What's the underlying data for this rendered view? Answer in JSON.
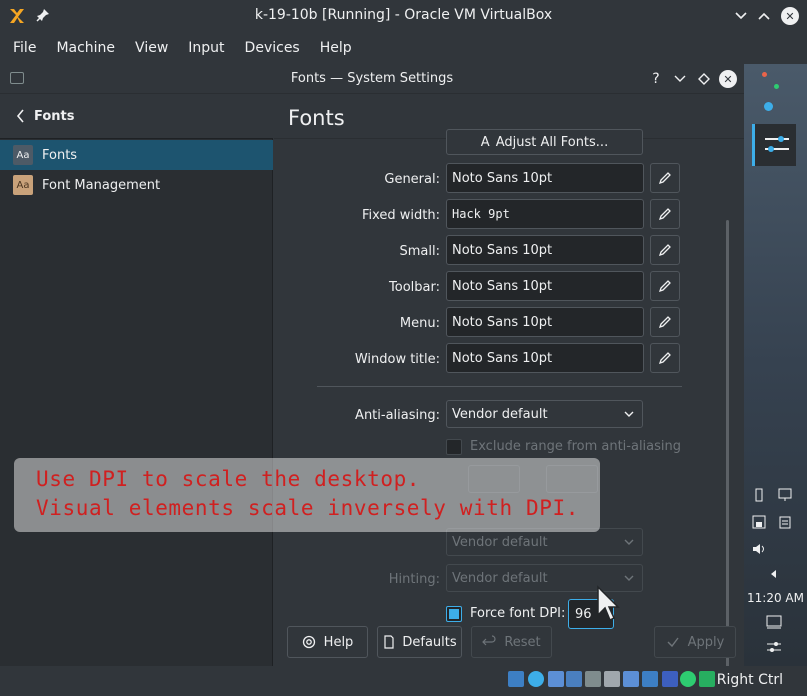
{
  "host_window": {
    "title": "k-19-10b [Running] - Oracle VM VirtualBox",
    "menu": [
      "File",
      "Machine",
      "View",
      "Input",
      "Devices",
      "Help"
    ],
    "host_key_label": "Right Ctrl"
  },
  "settings_window": {
    "title": "Fonts — System Settings",
    "help_button": "?"
  },
  "sidebar": {
    "back_title": "Fonts",
    "items": [
      {
        "label": "Fonts",
        "icon": "font-icon",
        "active": true
      },
      {
        "label": "Font Management",
        "icon": "font-management-icon",
        "active": false
      }
    ]
  },
  "main": {
    "page_title": "Fonts",
    "adjust_all_button": "Adjust All Fonts...",
    "font_rows": [
      {
        "label": "General:",
        "value": "Noto Sans 10pt"
      },
      {
        "label": "Fixed width:",
        "value": "Hack 9pt"
      },
      {
        "label": "Small:",
        "value": "Noto Sans 10pt"
      },
      {
        "label": "Toolbar:",
        "value": "Noto Sans 10pt"
      },
      {
        "label": "Menu:",
        "value": "Noto Sans 10pt"
      },
      {
        "label": "Window title:",
        "value": "Noto Sans 10pt"
      }
    ],
    "antialiasing_label": "Anti-aliasing:",
    "antialiasing_value": "Vendor default",
    "exclude_range_label": "Exclude range from anti-aliasing",
    "subpixel_value": "Vendor default",
    "hinting_label": "Hinting:",
    "hinting_value": "Vendor default",
    "force_dpi_label": "Force font DPI:",
    "force_dpi_value": "96",
    "force_dpi_checked": true
  },
  "footer": {
    "help": "Help",
    "defaults": "Defaults",
    "reset": "Reset",
    "apply": "Apply"
  },
  "panel": {
    "clock": "11:20 AM"
  },
  "overlay": {
    "line1": "Use DPI to scale the desktop.",
    "line2": "Visual elements scale inversely with DPI."
  },
  "colors": {
    "accent": "#3daee9",
    "selection": "#1d546f",
    "overlay_text": "#d02020"
  }
}
